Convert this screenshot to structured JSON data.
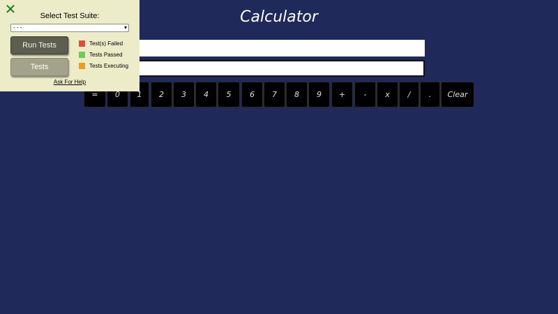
{
  "app": {
    "title": "Calculator"
  },
  "display": {
    "top_value": "",
    "bottom_value": ""
  },
  "keypad": {
    "keys": [
      "=",
      "0",
      "1",
      "2",
      "3",
      "4",
      "5",
      "6",
      "7",
      "8",
      "9",
      "+",
      "-",
      "x",
      "/",
      ".",
      "Clear"
    ]
  },
  "test_panel": {
    "close_icon": "close-x-icon",
    "suite_label": "Select Test Suite:",
    "suite_selected": "- - -",
    "run_button_label": "Run Tests",
    "tests_button_label": "Tests",
    "legend": [
      {
        "label": "Test(s) Failed",
        "color": "#e8493d"
      },
      {
        "label": "Tests Passed",
        "color": "#66d15a"
      },
      {
        "label": "Tests Executing",
        "color": "#f39c12"
      }
    ],
    "help_link": "Ask For Help"
  },
  "colors": {
    "background": "#1f2a5a",
    "panel": "#ececc8",
    "key": "#000000",
    "close_icon": "#1a7a1a"
  }
}
